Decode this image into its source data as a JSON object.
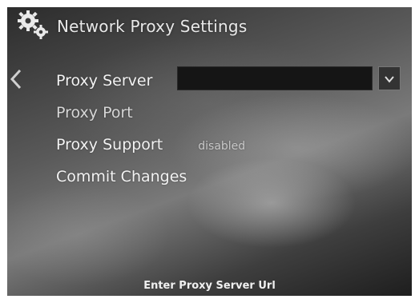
{
  "header": {
    "title": "Network Proxy Settings",
    "icon": "gears-icon"
  },
  "nav": {
    "back_icon": "chevron-left-icon"
  },
  "menu": {
    "items": [
      {
        "label": "Proxy Server",
        "value": ""
      },
      {
        "label": "Proxy Port",
        "value": ""
      },
      {
        "label": "Proxy Support",
        "value": "disabled"
      },
      {
        "label": "Commit Changes",
        "value": ""
      }
    ]
  },
  "proxy_server_field": {
    "value": "",
    "dropdown_icon": "chevron-down-icon"
  },
  "status": {
    "hint": "Enter Proxy Server Url"
  },
  "colors": {
    "text": "#f2f2f2",
    "field_bg": "#151515",
    "dropdown_bg": "#333333"
  }
}
